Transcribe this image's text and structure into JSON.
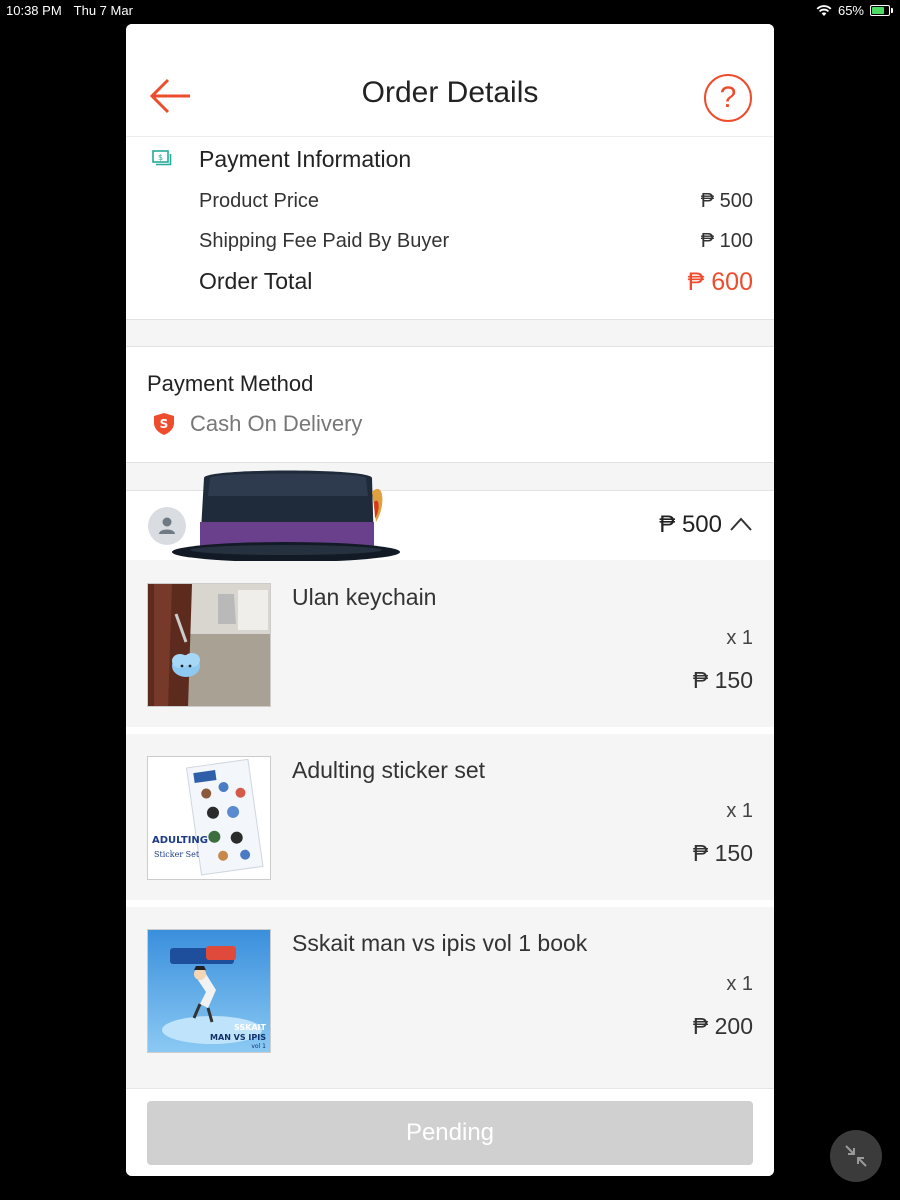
{
  "status_bar": {
    "time": "10:38 PM",
    "date": "Thu 7 Mar",
    "battery": "65%",
    "battery_level": 0.65
  },
  "header": {
    "title": "Order Details",
    "back_icon": "arrow-left-icon",
    "help_label": "?"
  },
  "payment_info": {
    "title": "Payment Information",
    "rows": [
      {
        "label": "Product Price",
        "value": "₱ 500"
      },
      {
        "label": "Shipping Fee Paid By Buyer",
        "value": "₱ 100"
      }
    ],
    "total_label": "Order Total",
    "total_value": "₱ 600"
  },
  "payment_method": {
    "title": "Payment Method",
    "value": "Cash On Delivery"
  },
  "shop": {
    "total": "₱ 500"
  },
  "items": [
    {
      "name": "Ulan keychain",
      "qty": "x 1",
      "price": "₱ 150"
    },
    {
      "name": "Adulting sticker set",
      "qty": "x 1",
      "price": "₱ 150"
    },
    {
      "name": "Sskait man vs ipis vol 1 book",
      "qty": "x 1",
      "price": "₱ 200"
    }
  ],
  "thumb_text": {
    "sticker_title": "ADULTING",
    "sticker_subtitle": "Sticker Set",
    "book_brand": "SSKAIT",
    "book_title": "MAN VS IPIS",
    "book_vol": "vol 1"
  },
  "footer": {
    "button": "Pending"
  },
  "colors": {
    "accent": "#ee4d2d",
    "teal": "#26aa99",
    "disabled": "#d0d0d0"
  }
}
